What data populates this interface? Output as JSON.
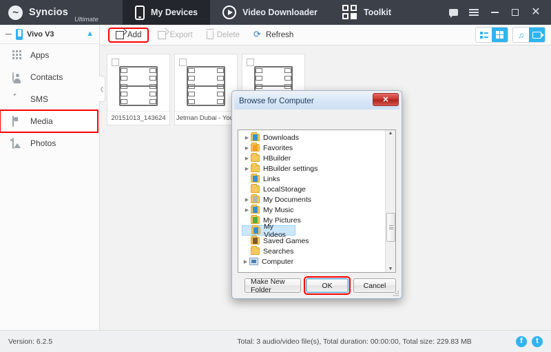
{
  "app": {
    "brand_name": "Syncios",
    "brand_edition": "Ultimate",
    "logo_icon": "syncios-wave-logo"
  },
  "titlebar": {
    "tabs": [
      {
        "label": "My Devices",
        "icon": "phone-icon",
        "active": true
      },
      {
        "label": "Video Downloader",
        "icon": "play-circle-icon",
        "active": false
      },
      {
        "label": "Toolkit",
        "icon": "grid-squares-icon",
        "active": false
      }
    ],
    "window_controls": [
      {
        "name": "feedback-icon",
        "glyph": "chat"
      },
      {
        "name": "menu-icon",
        "glyph": "hamburger"
      },
      {
        "name": "minimize-icon",
        "glyph": "minimize"
      },
      {
        "name": "maximize-icon",
        "glyph": "maximize"
      },
      {
        "name": "close-icon",
        "glyph": "close"
      }
    ]
  },
  "toolbar": {
    "add_label": "Add",
    "export_label": "Export",
    "delete_label": "Delete",
    "refresh_label": "Refresh",
    "view_buttons": [
      {
        "name": "list-view-icon",
        "active": false
      },
      {
        "name": "grid-view-icon",
        "active": true
      }
    ],
    "media_type_buttons": [
      {
        "name": "music-filter-icon",
        "active": false
      },
      {
        "name": "video-filter-icon",
        "active": true
      }
    ],
    "highlight_color": "#ff0000"
  },
  "sidebar": {
    "device_name": "Vivo V3",
    "device_icon": "phone-icon",
    "eject_icon": "eject-icon",
    "collapse_icon": "minus-icon",
    "items": [
      {
        "label": "Apps",
        "icon": "apps-icon",
        "selected": false,
        "highlighted": false
      },
      {
        "label": "Contacts",
        "icon": "contacts-icon",
        "selected": false,
        "highlighted": false
      },
      {
        "label": "SMS",
        "icon": "sms-icon",
        "selected": false,
        "highlighted": false
      },
      {
        "label": "Media",
        "icon": "media-icon",
        "selected": true,
        "highlighted": true
      },
      {
        "label": "Photos",
        "icon": "photos-icon",
        "selected": false,
        "highlighted": false
      }
    ],
    "collapse_tab_icon": "chevron-left-icon"
  },
  "content": {
    "thumbnails": [
      {
        "label": "20151013_143624",
        "icon": "film-strip-icon",
        "checked": false
      },
      {
        "label": "Jetman Dubai  - You...",
        "icon": "film-strip-icon",
        "checked": false
      },
      {
        "label": "",
        "icon": "film-strip-icon",
        "checked": false
      }
    ]
  },
  "statusbar": {
    "version": "Version: 6.2.5",
    "totals": "Total: 3 audio/video file(s), Total duration: 00:00:00, Total size: 229.83 MB",
    "social": [
      {
        "name": "facebook-icon",
        "glyph": "f"
      },
      {
        "name": "twitter-icon",
        "glyph": "t"
      }
    ]
  },
  "dialog": {
    "title": "Browse for Computer",
    "close_glyph": "✕",
    "tree": [
      {
        "label": "Downloads",
        "icon": "folder-downloads-icon",
        "expandable": true,
        "badge": "blue",
        "selected": false,
        "indent": 1
      },
      {
        "label": "Favorites",
        "icon": "folder-favorites-icon",
        "expandable": true,
        "badge": "star",
        "selected": false,
        "indent": 1
      },
      {
        "label": "HBuilder",
        "icon": "folder-icon",
        "expandable": true,
        "badge": "none",
        "selected": false,
        "indent": 1
      },
      {
        "label": "HBuilder settings",
        "icon": "folder-icon",
        "expandable": true,
        "badge": "none",
        "selected": false,
        "indent": 1
      },
      {
        "label": "Links",
        "icon": "folder-links-icon",
        "expandable": false,
        "badge": "blue",
        "selected": false,
        "indent": 1
      },
      {
        "label": "LocalStorage",
        "icon": "folder-icon",
        "expandable": false,
        "badge": "none",
        "selected": false,
        "indent": 1
      },
      {
        "label": "My Documents",
        "icon": "folder-documents-icon",
        "expandable": true,
        "badge": "grey",
        "selected": false,
        "indent": 1
      },
      {
        "label": "My Music",
        "icon": "folder-music-icon",
        "expandable": true,
        "badge": "blue",
        "selected": false,
        "indent": 1
      },
      {
        "label": "My Pictures",
        "icon": "folder-pictures-icon",
        "expandable": false,
        "badge": "green",
        "selected": false,
        "indent": 1
      },
      {
        "label": "My Videos",
        "icon": "folder-videos-icon",
        "expandable": false,
        "badge": "blue",
        "selected": true,
        "indent": 1
      },
      {
        "label": "Saved Games",
        "icon": "folder-savedgames-icon",
        "expandable": false,
        "badge": "dark",
        "selected": false,
        "indent": 1
      },
      {
        "label": "Searches",
        "icon": "folder-searches-icon",
        "expandable": false,
        "badge": "none",
        "selected": false,
        "indent": 1
      },
      {
        "label": "Computer",
        "icon": "computer-icon",
        "expandable": true,
        "badge": "none",
        "selected": false,
        "indent": 0
      }
    ],
    "buttons": {
      "make_new_folder": "Make New Folder",
      "ok": "OK",
      "cancel": "Cancel"
    },
    "ok_highlighted": true,
    "scrollbar": {
      "up_arrow": "▲",
      "down_arrow": "▼"
    }
  }
}
